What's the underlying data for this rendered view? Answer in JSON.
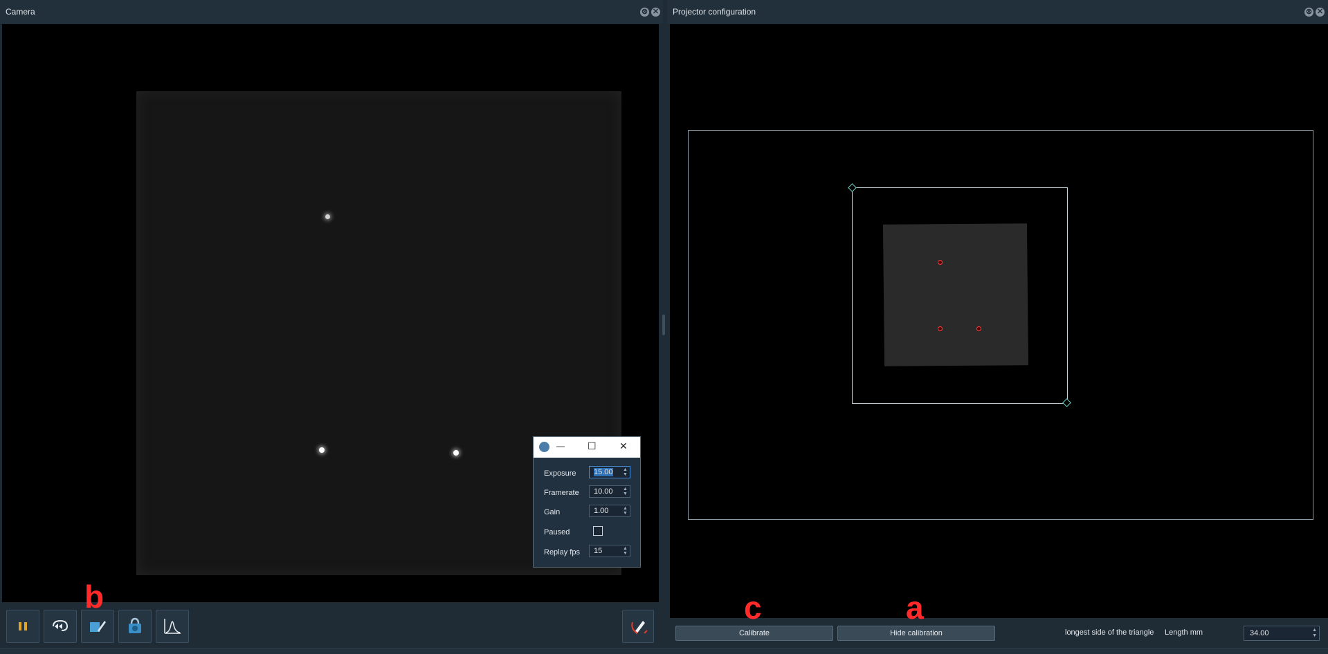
{
  "camera_panel": {
    "title": "Camera"
  },
  "projector_panel": {
    "title": "Projector configuration"
  },
  "title_buttons": {
    "float_glyph": "⊗",
    "close_glyph": "✕"
  },
  "camera_settings": {
    "window_controls": {
      "minimize": "—",
      "maximize": "☐",
      "close": "✕"
    },
    "exposure": {
      "label": "Exposure",
      "value": "15.00"
    },
    "framerate": {
      "label": "Framerate",
      "value": "10.00"
    },
    "gain": {
      "label": "Gain",
      "value": "1.00"
    },
    "paused": {
      "label": "Paused",
      "checked": false
    },
    "replay_fps": {
      "label": "Replay fps",
      "value": "15"
    }
  },
  "toolbar": {
    "icons": [
      "pause-icon",
      "replay-icon",
      "edit-icon",
      "snapshot-icon",
      "histogram-icon"
    ],
    "pen_icon": "pen-icon"
  },
  "projector_controls": {
    "calibrate_label": "Calibrate",
    "hide_calibration_label": "Hide calibration",
    "triangle_label": "longest side of the triangle",
    "length_label": "Length mm",
    "length_value": "34.00"
  },
  "annotations": {
    "b": "b",
    "c": "c",
    "a": "a"
  },
  "colors": {
    "background": "#1f2b35",
    "accent_pause": "#e0a52a",
    "calibration_outline": "#6fd1c5",
    "annotation_red": "#ff2b2b"
  }
}
